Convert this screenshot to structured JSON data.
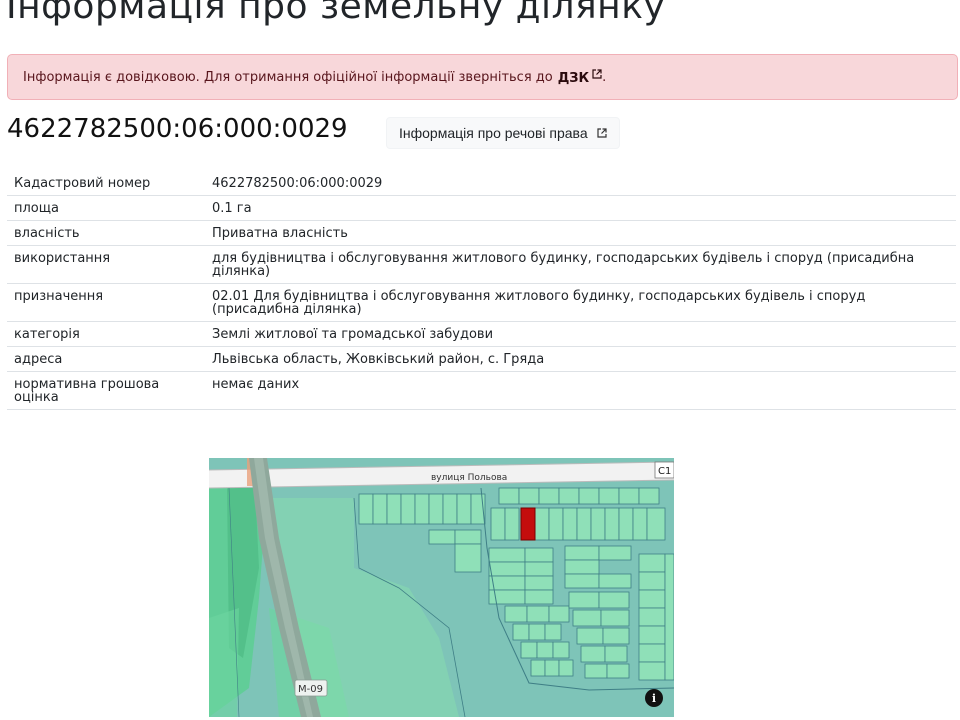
{
  "page": {
    "title": "Інформація про земельну ділянку"
  },
  "alert": {
    "text": "Інформація є довідковою. Для отримання офіційної інформації зверніться до",
    "link_label": "ДЗК",
    "suffix": "."
  },
  "parcel": {
    "cadastral_number": "4622782500:06:000:0029",
    "rights_button_label": "Інформація про речові права"
  },
  "details": [
    {
      "label": "Кадастровий номер",
      "value": "4622782500:06:000:0029"
    },
    {
      "label": "площа",
      "value": "0.1 га"
    },
    {
      "label": "власність",
      "value": "Приватна власність"
    },
    {
      "label": "використання",
      "value": "для будівництва і обслуговування житлового будинку, господарських будівель і споруд (присадибна ділянка)"
    },
    {
      "label": "призначення",
      "value": "02.01 Для будівництва і обслуговування житлового будинку, господарських будівель і споруд (присадибна ділянка)"
    },
    {
      "label": "категорія",
      "value": "Землі житлової та громадської забудови"
    },
    {
      "label": "адреса",
      "value": "Львівська область, Жовківський район, с. Гряда"
    },
    {
      "label": "нормативна грошова оцінка",
      "value": "немає даних"
    }
  ],
  "map": {
    "street_label": "вулиця Польова",
    "road_label": "М-09",
    "corner_label": "С1",
    "info_button_glyph": "i",
    "colors": {
      "base": "#7ec4b8",
      "parcel": "#8fe0b8",
      "parcel_stroke": "#3f7f86",
      "selected": "#c40d0d",
      "road": "#eeeeee",
      "forest": "#5ccf92"
    }
  },
  "icons": {
    "external_link": "external-link-icon",
    "map_info": "info-icon"
  }
}
